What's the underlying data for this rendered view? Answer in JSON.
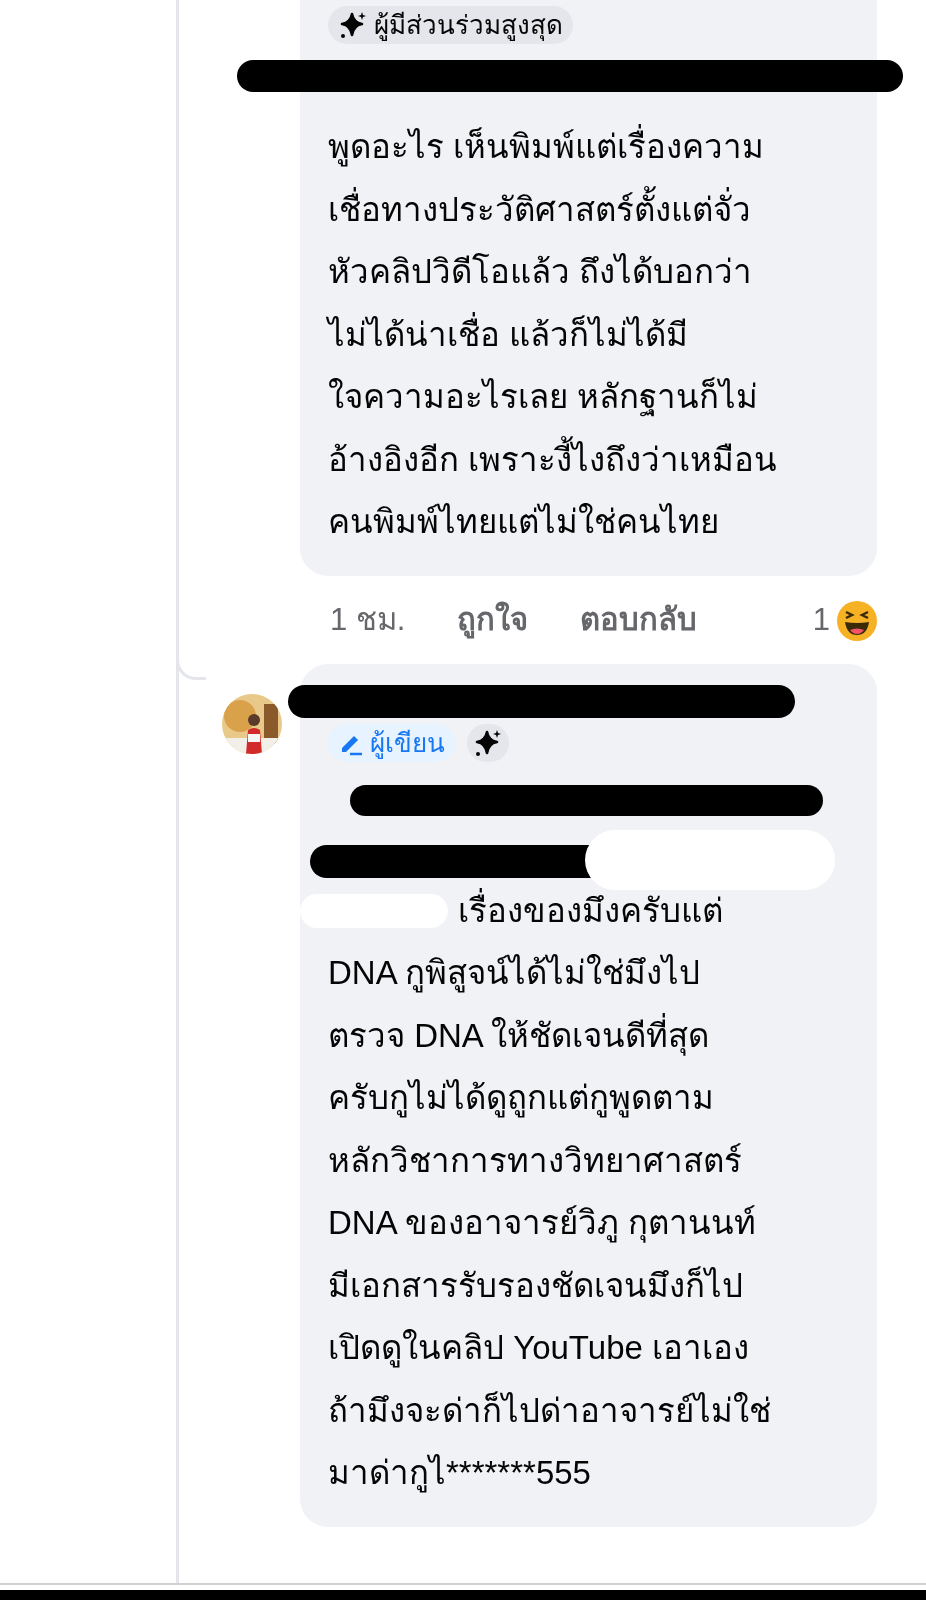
{
  "comments": [
    {
      "badges": [
        {
          "kind": "top-fan",
          "label": "ผู้มีส่วนร่วมสูงสุด"
        }
      ],
      "text": "พูดอะไร เห็นพิมพ์แต่เรื่องความ\nเชื่อทางประวัติศาสตร์ตั้งแต่จั่ว\nหัวคลิปวิดีโอแล้ว ถึงได้บอกว่า\nไม่ได้น่าเชื่อ แล้วก็ไม่ได้มี\nใจความอะไรเลย หลักฐานก็ไม่\nอ้างอิงอีก เพราะงี้ไงถึงว่าเหมือน\nคนพิมพ์ไทยแต่ไม่ใช่คนไทย",
      "time": "1 ชม.",
      "actions": [
        "ถูกใจ",
        "ตอบกลับ"
      ],
      "reaction_count": "1"
    },
    {
      "badges": [
        {
          "kind": "author",
          "label": "ผู้เขียน"
        },
        {
          "kind": "top-fan"
        }
      ],
      "text": "เรื่องของมึงครับแต่\nDNA กูพิสูจน์ได้ไม่ใช่มึงไป\nตรวจ DNA ให้ชัดเจนดีที่สุด\nครับกูไม่ได้ดูถูกแต่กูพูดตาม\nหลักวิชาการทางวิทยาศาสตร์\nDNA ของอาจารย์วิภู กุตานนท์\nมีเอกสารรับรองชัดเจนมึงก็ไป\nเปิดดูในคลิป YouTube เอาเอง\nถ้ามึงจะด่าก็ไปด่าอาจารย์ไม่ใช่\nมาด่ากูไ*******555"
    }
  ]
}
